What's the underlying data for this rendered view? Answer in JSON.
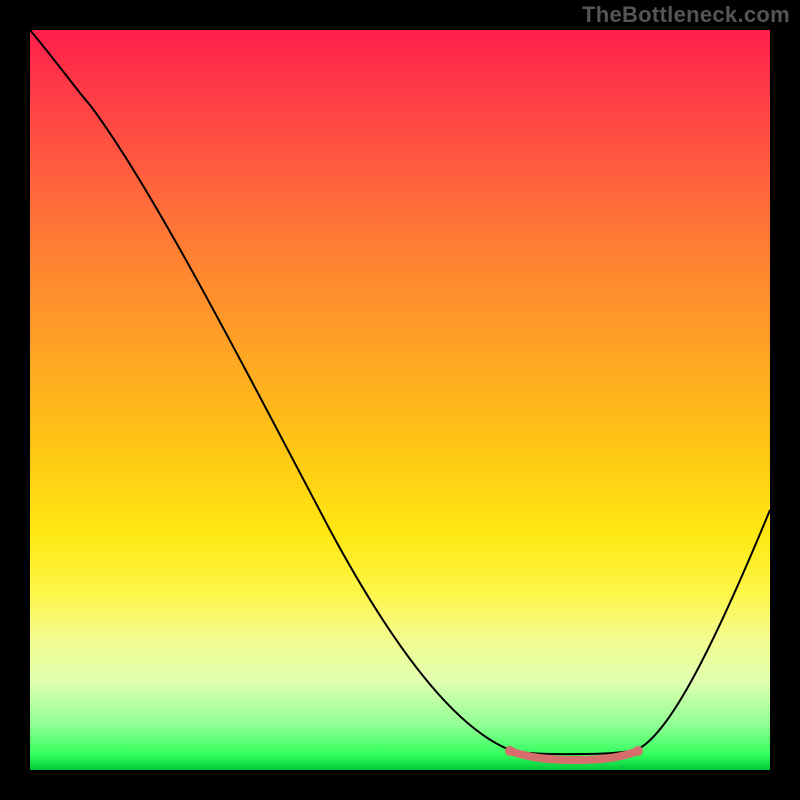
{
  "watermark": "TheBottleneck.com",
  "colors": {
    "gradient_top": "#ff1f4b",
    "gradient_bottom": "#00c738",
    "curve": "#000000",
    "highlight": "#d66e6e",
    "frame_background": "#000000"
  },
  "chart_data": {
    "type": "line",
    "title": "",
    "xlabel": "",
    "ylabel": "",
    "xlim": [
      0,
      100
    ],
    "ylim": [
      0,
      100
    ],
    "grid": false,
    "legend": false,
    "description": "Bottleneck-style curve: high mismatch (red, top) falling to an optimal green minimum around x≈70–82, then rising again. Salmon band marks the flat optimal region.",
    "x": [
      0,
      4,
      8,
      16,
      27,
      41,
      50,
      58,
      65,
      70,
      74,
      78,
      82,
      86,
      92,
      100
    ],
    "values": [
      100,
      95,
      90,
      79,
      58,
      32,
      15,
      6,
      3,
      2.5,
      1.5,
      1.3,
      2.5,
      5,
      16,
      35
    ],
    "highlight_range_x": [
      65,
      82
    ],
    "highlight_points": [
      {
        "x": 65,
        "y": 2.6
      },
      {
        "x": 82,
        "y": 2.6
      }
    ]
  }
}
